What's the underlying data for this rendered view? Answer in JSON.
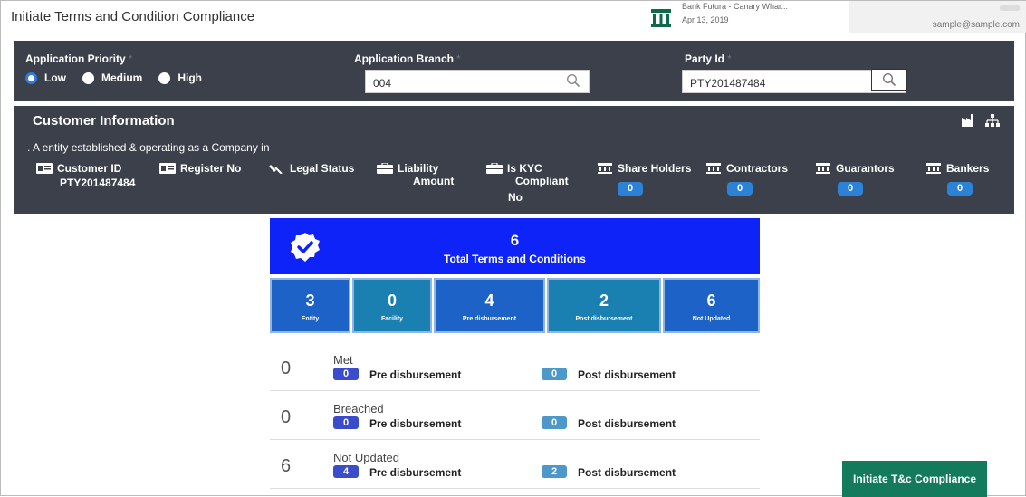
{
  "header": {
    "title": "Initiate Terms and Condition Compliance",
    "bank_name": "Bank Futura - Canary Whar...",
    "date": "Apr 13, 2019",
    "email": "sample@sample.com"
  },
  "form": {
    "priority_label": "Application Priority",
    "priority_options": [
      "Low",
      "Medium",
      "High"
    ],
    "priority_selected": "Low",
    "branch_label": "Application Branch",
    "branch_value": "004",
    "party_label": "Party Id",
    "party_value": "PTY201487484",
    "required_mark": "*"
  },
  "customer": {
    "title": "Customer Information",
    "description": ". A entity established & operating as a Company in",
    "fields": {
      "customer_id_label": "Customer ID",
      "customer_id_value": "PTY201487484",
      "register_no_label": "Register No",
      "legal_status_label": "Legal Status",
      "liability_label_1": "Liability",
      "liability_label_2": "Amount",
      "kyc_label_1": "Is KYC",
      "kyc_label_2": "Compliant",
      "kyc_value": "No",
      "share_holders_label": "Share Holders",
      "share_holders_count": "0",
      "contractors_label": "Contractors",
      "contractors_count": "0",
      "guarantors_label": "Guarantors",
      "guarantors_count": "0",
      "bankers_label": "Bankers",
      "bankers_count": "0"
    }
  },
  "summary": {
    "total": "6",
    "total_label": "Total Terms and Conditions",
    "stats": [
      {
        "value": "3",
        "label": "Entity"
      },
      {
        "value": "0",
        "label": "Facility"
      },
      {
        "value": "4",
        "label": "Pre disbursement"
      },
      {
        "value": "2",
        "label": "Post disbursement"
      },
      {
        "value": "6",
        "label": "Not Updated"
      }
    ]
  },
  "status_rows": [
    {
      "count": "0",
      "label": "Met",
      "pre": "0",
      "pre_label": "Pre disbursement",
      "post": "0",
      "post_label": "Post disbursement"
    },
    {
      "count": "0",
      "label": "Breached",
      "pre": "0",
      "pre_label": "Pre disbursement",
      "post": "0",
      "post_label": "Post disbursement"
    },
    {
      "count": "6",
      "label": "Not Updated",
      "pre": "4",
      "pre_label": "Pre disbursement",
      "post": "2",
      "post_label": "Post disbursement"
    }
  ],
  "actions": {
    "initiate_label": "Initiate T&c Compliance"
  },
  "colors": {
    "panel": "#3b404a",
    "total_card": "#0d23f7",
    "stat_blue": "#1d63c7",
    "stat_teal": "#1a7fb1",
    "cta": "#137a5c"
  }
}
